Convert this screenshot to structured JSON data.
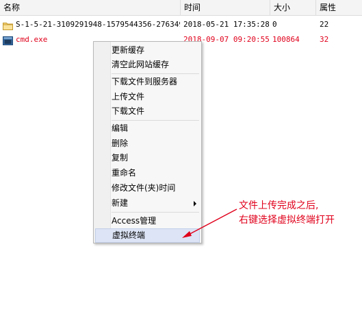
{
  "columns": {
    "name": "名称",
    "time": "时间",
    "size": "大小",
    "attr": "属性"
  },
  "files": [
    {
      "name": "S-1-5-21-3109291948-1579544356-276349...",
      "time": "2018-05-21 17:35:28",
      "size": "0",
      "attr": "22",
      "icon": "folder-icon"
    },
    {
      "name": "cmd.exe",
      "time": "2018-09-07 09:20:55",
      "size": "100864",
      "attr": "32",
      "icon": "file-icon"
    }
  ],
  "context_menu": {
    "group1": [
      "更新缓存",
      "清空此网站缓存"
    ],
    "group2": [
      "下载文件到服务器",
      "上传文件",
      "下载文件"
    ],
    "group3": [
      "编辑",
      "删除",
      "复制",
      "重命名",
      "修改文件(夹)时间",
      "新建"
    ],
    "group4": [
      "Access管理",
      "虚拟终端"
    ]
  },
  "annotation": {
    "line1": "文件上传完成之后,",
    "line2": "右键选择虚拟终端打开"
  },
  "colors": {
    "highlight_red": "#e0001b",
    "menu_hover": "#dce4f5"
  }
}
